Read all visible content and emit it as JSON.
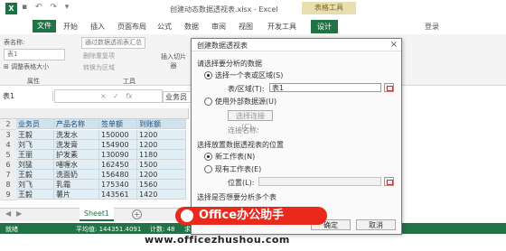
{
  "app": {
    "window_title": "创建动态数据透视表.xlsx - Excel",
    "context_tab_group": "表格工具",
    "login_label": "登录",
    "logo_letter": "X"
  },
  "ribbon": {
    "tabs": [
      "文件",
      "开始",
      "插入",
      "页面布局",
      "公式",
      "数据",
      "审阅",
      "视图",
      "开发工具",
      "设计"
    ],
    "table_name_label": "表名称:",
    "table_name_value": "表1",
    "resize_table": "调整表格大小",
    "summarize_pivot": "通过数据透视表汇总",
    "remove_duplicates": "删除重复项",
    "convert_to_range": "转换为区域",
    "insert_slicer": "插入切片器",
    "group_properties": "属性",
    "group_tools": "工具"
  },
  "formula_bar": {
    "name_box": "表1",
    "cell_value": "业务员"
  },
  "sheet": {
    "columns": [
      "业务员",
      "产品名称",
      "签单额",
      "到账额"
    ],
    "rows": [
      {
        "num": "3",
        "cells": [
          "王毅",
          "洗发水",
          "150000",
          "1200"
        ]
      },
      {
        "num": "4",
        "cells": [
          "刘飞",
          "洗发膏",
          "154900",
          "1200"
        ]
      },
      {
        "num": "5",
        "cells": [
          "王丽",
          "护发素",
          "130090",
          "1180"
        ]
      },
      {
        "num": "6",
        "cells": [
          "刘猛",
          "啫喱水",
          "162450",
          "1500"
        ]
      },
      {
        "num": "7",
        "cells": [
          "王毅",
          "洗面奶",
          "156480",
          "1200"
        ]
      },
      {
        "num": "8",
        "cells": [
          "刘飞",
          "乳霜",
          "175340",
          "1560"
        ]
      },
      {
        "num": "9",
        "cells": [
          "王毅",
          "薯片",
          "143561",
          "1420"
        ]
      }
    ],
    "header_row_num": "2",
    "tab_name": "Sheet1"
  },
  "status_bar": {
    "ready": "就绪",
    "average": "平均值: 144351.4091",
    "count": "计数: 48",
    "sum": "求和: 31"
  },
  "dialog": {
    "title": "创建数据透视表",
    "section_data": "请选择要分析的数据",
    "opt_select_range": "选择一个表或区域(S)",
    "table_range_label": "表/区域(T):",
    "table_range_value": "表1",
    "opt_external": "使用外部数据源(U)",
    "choose_connection": "选择连接(C)...",
    "connection_name": "连接名称:",
    "section_location": "选择放置数据透视表的位置",
    "opt_new_sheet": "新工作表(N)",
    "opt_existing_sheet": "现有工作表(E)",
    "location_label": "位置(L):",
    "section_multi": "选择是否想要分析多个表",
    "ok": "确定",
    "cancel": "取消"
  },
  "watermark": {
    "badge_text": "Office办公助手",
    "url": "www.officezhushou.com"
  },
  "colors": {
    "excel_green": "#217346",
    "table_header_fill": "#cfe2ee",
    "table_row_fill": "#e2eef6",
    "watermark_red": "#e8291c"
  }
}
